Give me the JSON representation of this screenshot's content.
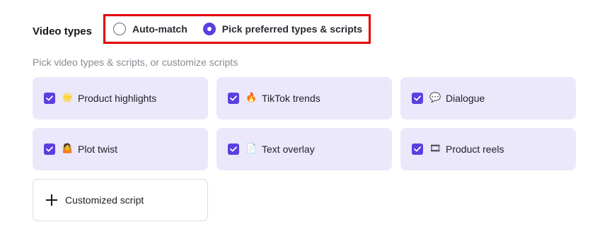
{
  "section": {
    "label": "Video types"
  },
  "mode": {
    "options": [
      {
        "label": "Auto-match",
        "selected": false
      },
      {
        "label": "Pick preferred types & scripts",
        "selected": true
      }
    ]
  },
  "hint": "Pick video types & scripts, or customize scripts",
  "types": [
    {
      "label": "Product highlights",
      "icon": "sparkle-sun-icon",
      "emoji": "🌟",
      "checked": true
    },
    {
      "label": "TikTok trends",
      "icon": "fire-icon",
      "emoji": "🔥",
      "checked": true
    },
    {
      "label": "Dialogue",
      "icon": "speech-bubble-icon",
      "emoji": "💬",
      "checked": true
    },
    {
      "label": "Plot twist",
      "icon": "person-shrug-icon",
      "emoji": "🤷",
      "checked": true
    },
    {
      "label": "Text overlay",
      "icon": "document-icon",
      "emoji": "📄",
      "checked": true
    },
    {
      "label": "Product reels",
      "icon": "film-reel-icon",
      "emoji": "🎞",
      "checked": true
    }
  ],
  "custom": {
    "label": "Customized script"
  },
  "colors": {
    "accent": "#5b3fe0",
    "card_bg": "#ebe8fb",
    "highlight_border": "#e00000"
  }
}
